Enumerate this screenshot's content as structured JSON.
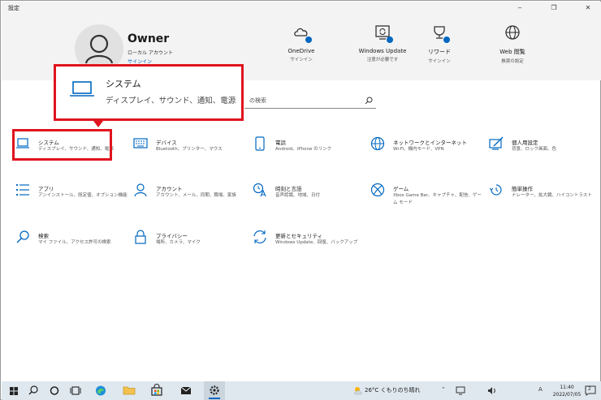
{
  "window": {
    "title": "設定",
    "minimize": "‒",
    "maximize": "❐",
    "close": "✕"
  },
  "user": {
    "name": "Owner",
    "account_type": "ローカル アカウント",
    "signin_link": "サインイン"
  },
  "quick_links": [
    {
      "title": "OneDrive",
      "subtitle": "サインイン",
      "icon": "onedrive-cloud-icon"
    },
    {
      "title": "Windows Update",
      "subtitle": "注意が必要です",
      "icon": "windows-update-icon"
    },
    {
      "title": "リワード",
      "subtitle": "サインイン",
      "icon": "rewards-trophy-icon"
    },
    {
      "title": "Web 閲覧",
      "subtitle": "推奨の設定",
      "icon": "globe-icon"
    }
  ],
  "callout": {
    "title": "システム",
    "description": "ディスプレイ、サウンド、通知、電源"
  },
  "search": {
    "placeholder": "の検索"
  },
  "tiles": [
    {
      "title": "システム",
      "description": "ディスプレイ、サウンド、通知、電源",
      "icon": "laptop-icon"
    },
    {
      "title": "デバイス",
      "description": "Bluetooth、プリンター、マウス",
      "icon": "keyboard-icon"
    },
    {
      "title": "電話",
      "description": "Android、iPhone のリンク",
      "icon": "phone-icon"
    },
    {
      "title": "ネットワークとインターネット",
      "description": "Wi-Fi、機内モード、VPN",
      "icon": "globe-icon"
    },
    {
      "title": "個人用設定",
      "description": "背景、ロック画面、色",
      "icon": "paint-icon"
    },
    {
      "title": "アプリ",
      "description": "アンインストール、既定値、オプション機能",
      "icon": "apps-list-icon"
    },
    {
      "title": "アカウント",
      "description": "アカウント、メール、同期、職場、家族",
      "icon": "person-icon"
    },
    {
      "title": "時刻と言語",
      "description": "音声認識、地域、日付",
      "icon": "time-language-icon"
    },
    {
      "title": "ゲーム",
      "description": "Xbox Game Bar、キャプチャ、配信、ゲーム モード",
      "icon": "xbox-icon"
    },
    {
      "title": "簡単操作",
      "description": "ナレーター、拡大鏡、ハイコントラスト",
      "icon": "ease-of-access-icon"
    },
    {
      "title": "検索",
      "description": "マイ ファイル、アクセス許可の検索",
      "icon": "search-icon"
    },
    {
      "title": "プライバシー",
      "description": "場所、カメラ、マイク",
      "icon": "lock-icon"
    },
    {
      "title": "更新とセキュリティ",
      "description": "Windows Update、回復、バックアップ",
      "icon": "sync-icon"
    }
  ],
  "taskbar": {
    "weather": "26°C くもりのち晴れ",
    "ime": "A",
    "time": "11:40",
    "date": "2022/07/05",
    "notification_count": "2"
  },
  "colors": {
    "accent": "#0067c0",
    "highlight": "#e0141e",
    "header_bg": "#f3f3f3",
    "taskbar_bg": "#dfe8ef"
  }
}
